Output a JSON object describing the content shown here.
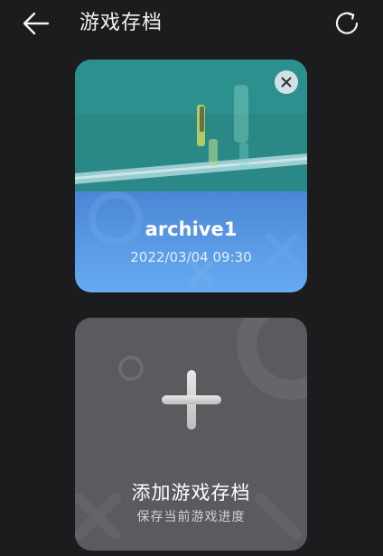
{
  "header": {
    "title": "游戏存档",
    "back_icon": "arrow-left-icon",
    "refresh_icon": "refresh-icon"
  },
  "save_card": {
    "name": "archive1",
    "timestamp": "2022/03/04 09:30",
    "delete_icon": "close-icon",
    "thumbnail_colors": {
      "water": "#2b8f8c",
      "info_gradient_top": "#4b86d4",
      "info_gradient_bottom": "#66aaf0"
    }
  },
  "add_card": {
    "title": "添加游戏存档",
    "subtitle": "保存当前游戏进度",
    "icon": "plus-icon",
    "background": "#5a5b5f"
  }
}
